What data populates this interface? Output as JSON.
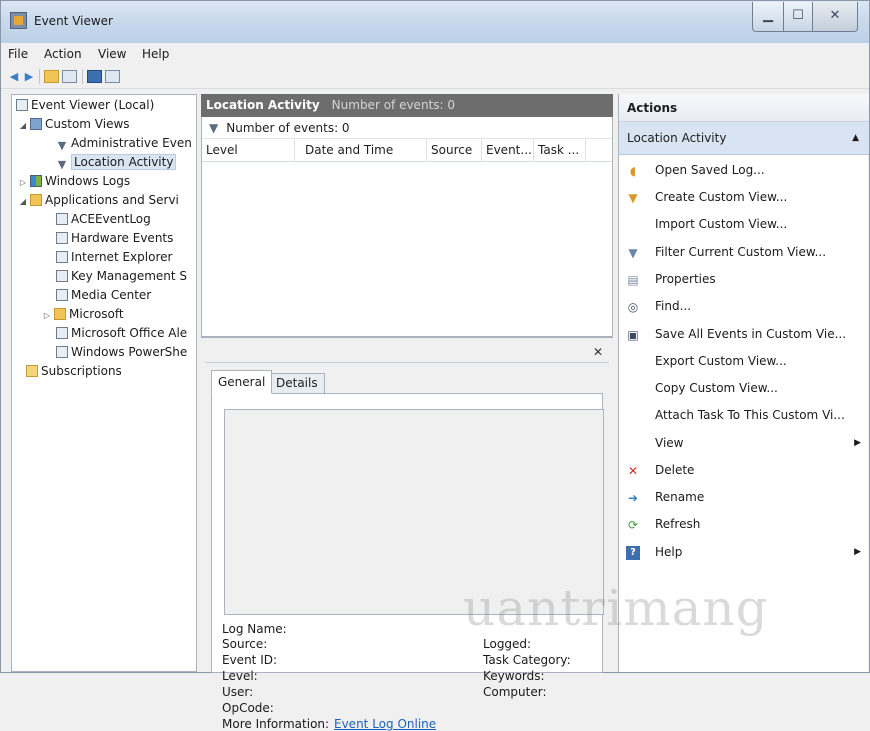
{
  "window": {
    "title": "Event Viewer"
  },
  "menu": [
    "File",
    "Action",
    "View",
    "Help"
  ],
  "tree": {
    "items": [
      {
        "label": "Event Viewer (Local)",
        "depth": 0
      },
      {
        "label": "Custom Views",
        "depth": 1
      },
      {
        "label": "Administrative Even",
        "depth": 2
      },
      {
        "label": "Location Activity",
        "depth": 2
      },
      {
        "label": "Windows Logs",
        "depth": 1
      },
      {
        "label": "Applications and Servi",
        "depth": 1
      },
      {
        "label": "ACEEventLog",
        "depth": 2
      },
      {
        "label": "Hardware Events",
        "depth": 2
      },
      {
        "label": "Internet Explorer",
        "depth": 2
      },
      {
        "label": "Key Management S",
        "depth": 2
      },
      {
        "label": "Media Center",
        "depth": 2
      },
      {
        "label": "Microsoft",
        "depth": 2
      },
      {
        "label": "Microsoft Office Ale",
        "depth": 2
      },
      {
        "label": "Windows PowerShe",
        "depth": 2
      },
      {
        "label": "Subscriptions",
        "depth": 1
      }
    ]
  },
  "middle": {
    "header_title": "Location Activity",
    "header_count": "Number of events: 0",
    "filter_text": "Number of events: 0",
    "columns": [
      "Level",
      "Date and Time",
      "Source",
      "Event...",
      "Task ..."
    ],
    "tabs": [
      "General",
      "Details"
    ],
    "fields_left": [
      "Log Name:",
      "Source:",
      "Event ID:",
      "Level:",
      "User:",
      "OpCode:",
      "More Information:"
    ],
    "fields_right": [
      "Logged:",
      "Task Category:",
      "Keywords:",
      "Computer:"
    ],
    "more_info_link": "Event Log Online"
  },
  "actions": {
    "header": "Actions",
    "section": "Location Activity",
    "items": [
      {
        "label": "Open Saved Log...",
        "icon": "open-log-icon"
      },
      {
        "label": "Create Custom View...",
        "icon": "filter-icon"
      },
      {
        "label": "Import Custom View...",
        "icon": ""
      },
      {
        "label": "Filter Current Custom View...",
        "icon": "filter-icon"
      },
      {
        "label": "Properties",
        "icon": "properties-icon"
      },
      {
        "label": "Find...",
        "icon": "binoculars-icon"
      },
      {
        "label": "Save All Events in Custom Vie...",
        "icon": "save-icon"
      },
      {
        "label": "Export Custom View...",
        "icon": ""
      },
      {
        "label": "Copy Custom View...",
        "icon": ""
      },
      {
        "label": "Attach Task To This Custom Vi...",
        "icon": ""
      },
      {
        "label": "View",
        "icon": ""
      },
      {
        "label": "Delete",
        "icon": "delete-icon"
      },
      {
        "label": "Rename",
        "icon": "rename-icon"
      },
      {
        "label": "Refresh",
        "icon": "refresh-icon"
      },
      {
        "label": "Help",
        "icon": "help-icon"
      }
    ]
  },
  "watermark": "uantrimang",
  "colors": {
    "header_dark": "#6d6d6d",
    "selection": "#d8e4f1",
    "link": "#1f5fbf",
    "delete_red": "#d12b2b"
  }
}
